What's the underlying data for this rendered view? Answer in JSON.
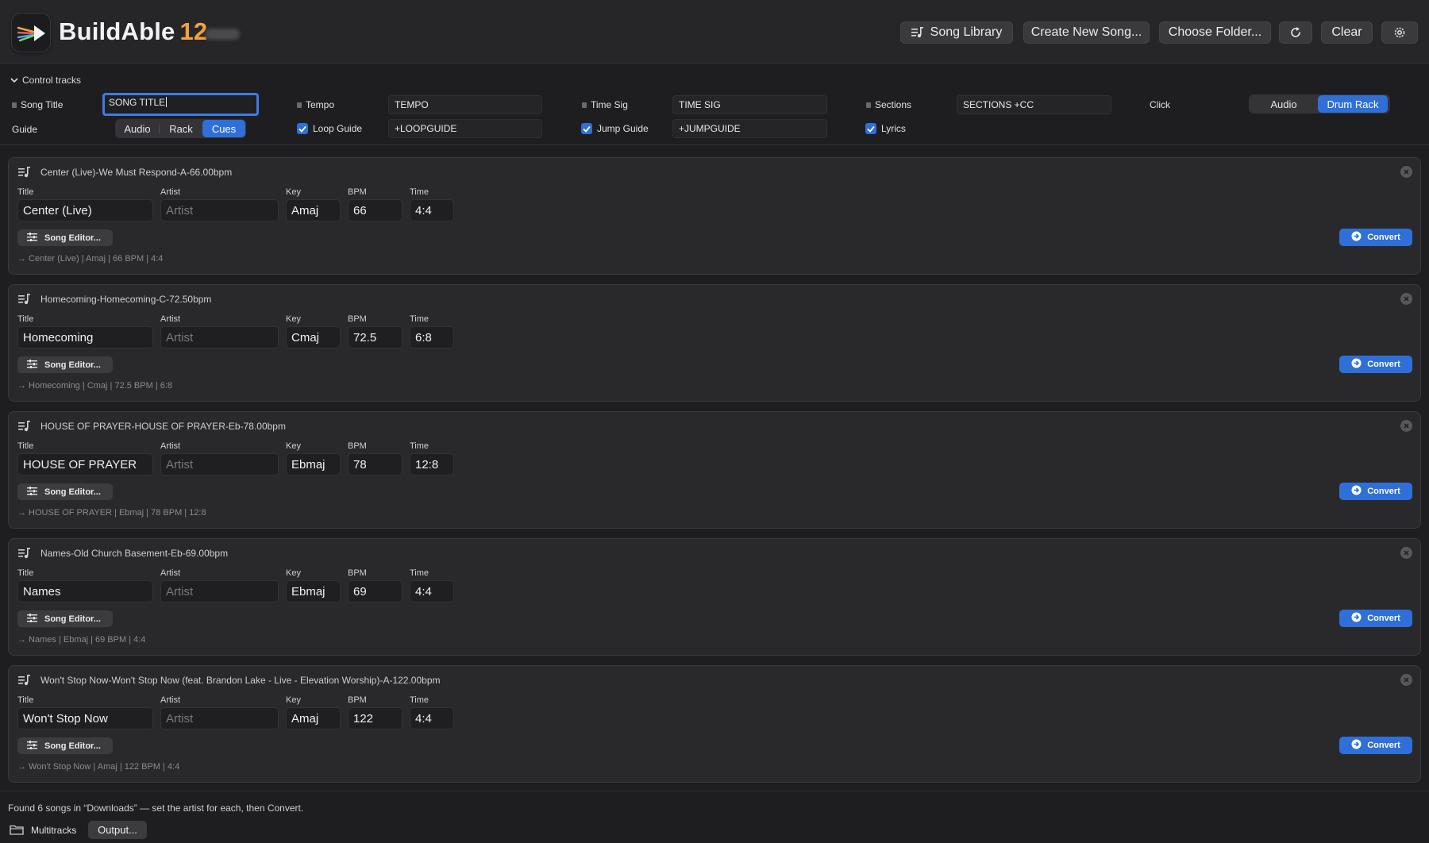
{
  "app": {
    "name": "BuildAble",
    "version": "12"
  },
  "header": {
    "song_library": "Song Library",
    "create_new": "Create New Song...",
    "choose_folder": "Choose Folder...",
    "clear": "Clear"
  },
  "control_tracks": {
    "toggle_label": "Control tracks",
    "song_title_label": "Song Title",
    "song_title_value": "SONG TITLE",
    "tempo_label": "Tempo",
    "tempo_value": "TEMPO",
    "timesig_label": "Time Sig",
    "timesig_value": "TIME SIG",
    "sections_label": "Sections",
    "sections_value": "SECTIONS +CC",
    "click_label": "Click",
    "click_options": [
      "Audio",
      "Drum Rack"
    ],
    "click_selected": "Drum Rack",
    "guide_label": "Guide",
    "guide_options": [
      "Audio",
      "Rack",
      "Cues"
    ],
    "guide_selected": "Cues",
    "loop_guide_label": "Loop Guide",
    "loop_guide_checked": true,
    "loop_guide_value": "+LOOPGUIDE",
    "jump_guide_label": "Jump Guide",
    "jump_guide_checked": true,
    "jump_guide_value": "+JUMPGUIDE",
    "lyrics_label": "Lyrics",
    "lyrics_checked": true
  },
  "field_labels": {
    "title": "Title",
    "artist": "Artist",
    "key": "Key",
    "bpm": "BPM",
    "time": "Time"
  },
  "artist_placeholder": "Artist",
  "song_editor_label": "Song Editor...",
  "convert_label": "Convert",
  "songs": [
    {
      "filename": "Center (Live)-We Must Respond-A-66.00bpm",
      "title": "Center (Live)",
      "artist": "",
      "key": "Amaj",
      "bpm": "66",
      "time": "4:4",
      "summary": "→ Center (Live) | Amaj | 66 BPM | 4:4"
    },
    {
      "filename": "Homecoming-Homecoming-C-72.50bpm",
      "title": "Homecoming",
      "artist": "",
      "key": "Cmaj",
      "bpm": "72.5",
      "time": "6:8",
      "summary": "→ Homecoming | Cmaj | 72.5 BPM | 6:8"
    },
    {
      "filename": "HOUSE OF PRAYER-HOUSE OF PRAYER-Eb-78.00bpm",
      "title": "HOUSE OF PRAYER",
      "artist": "",
      "key": "Ebmaj",
      "bpm": "78",
      "time": "12:8",
      "summary": "→ HOUSE OF PRAYER | Ebmaj | 78 BPM | 12:8"
    },
    {
      "filename": "Names-Old Church Basement-Eb-69.00bpm",
      "title": "Names",
      "artist": "",
      "key": "Ebmaj",
      "bpm": "69",
      "time": "4:4",
      "summary": "→ Names | Ebmaj | 69 BPM | 4:4"
    },
    {
      "filename": "Won't Stop Now-Won't Stop Now (feat. Brandon Lake - Live - Elevation Worship)-A-122.00bpm",
      "title": "Won't Stop Now",
      "artist": "",
      "key": "Amaj",
      "bpm": "122",
      "time": "4:4",
      "summary": "→ Won't Stop Now | Amaj | 122 BPM | 4:4"
    }
  ],
  "footer": {
    "status": "Found 6 songs in “Downloads” — set the artist for each, then Convert.",
    "multitracks": "Multitracks",
    "output": "Output..."
  },
  "colors": {
    "accent": "#2f6fd8",
    "version": "#f0a340",
    "background": "#1e1e20"
  }
}
